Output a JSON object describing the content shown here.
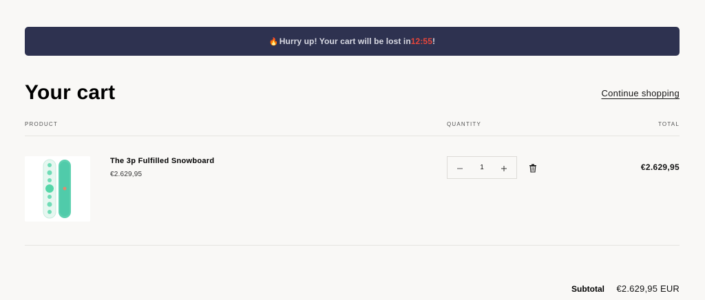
{
  "banner": {
    "icon": "fire-icon",
    "prefix": "Hurry up! Your cart will be lost in ",
    "timer": "12:55",
    "suffix": "!",
    "timer_color": "#e8463b",
    "background": "#2e3250"
  },
  "header": {
    "title": "Your cart",
    "continue_label": "Continue shopping"
  },
  "columns": {
    "product": "PRODUCT",
    "quantity": "QUANTITY",
    "total": "TOTAL"
  },
  "items": [
    {
      "name": "The 3p Fulfilled Snowboard",
      "price": "€2.629,95",
      "quantity": "1",
      "total": "€2.629,95",
      "decrease_icon": "minus-icon",
      "increase_icon": "plus-icon",
      "remove_icon": "trash-icon"
    }
  ],
  "summary": {
    "subtotal_label": "Subtotal",
    "subtotal_value": "€2.629,95 EUR"
  }
}
